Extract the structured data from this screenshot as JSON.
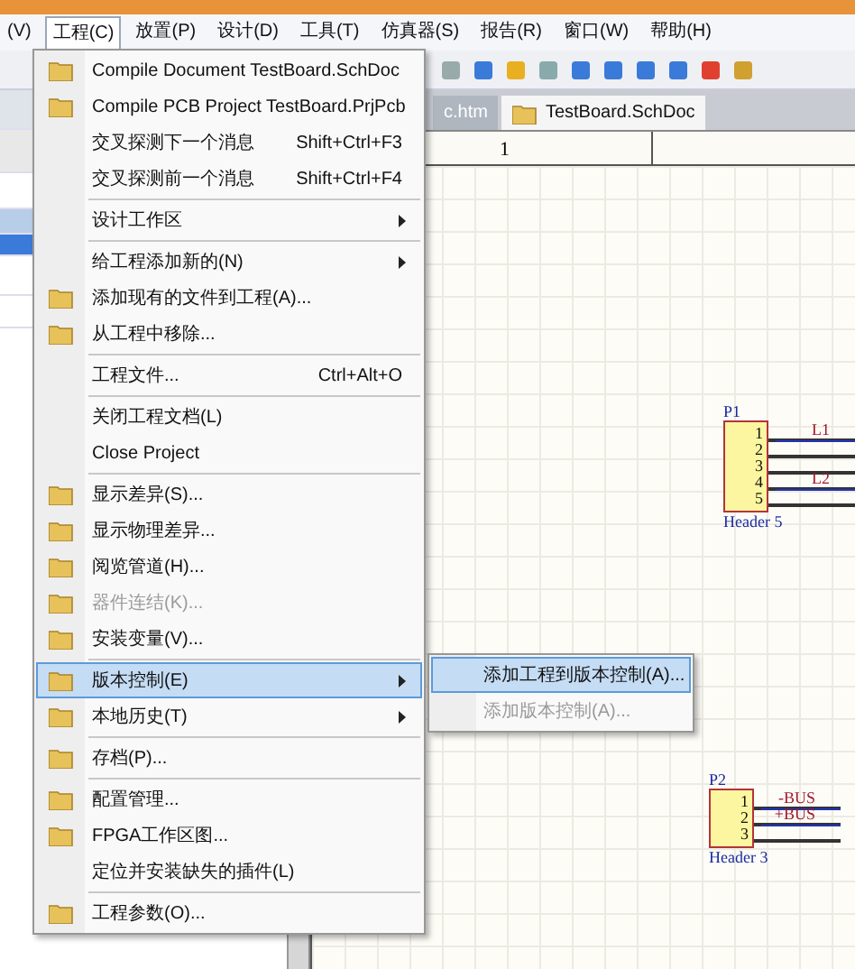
{
  "menubar": [
    {
      "label": "(V)",
      "selected": false
    },
    {
      "label": "工程(C)",
      "selected": true
    },
    {
      "label": "放置(P)",
      "selected": false
    },
    {
      "label": "设计(D)",
      "selected": false
    },
    {
      "label": "工具(T)",
      "selected": false
    },
    {
      "label": "仿真器(S)",
      "selected": false
    },
    {
      "label": "报告(R)",
      "selected": false
    },
    {
      "label": "窗口(W)",
      "selected": false
    },
    {
      "label": "帮助(H)",
      "selected": false
    }
  ],
  "document_tabs": [
    {
      "label": "c.htm",
      "selected": false
    },
    {
      "label": "TestBoard.SchDoc",
      "selected": true
    }
  ],
  "ruler": {
    "label": "1"
  },
  "menu": {
    "items": [
      {
        "kind": "icon_item",
        "label": "Compile Document TestBoard.SchDoc",
        "disabled": false,
        "selected": false,
        "submenu": false
      },
      {
        "kind": "icon_item",
        "label": "Compile PCB Project TestBoard.PrjPcb",
        "disabled": false,
        "selected": false,
        "submenu": false
      },
      {
        "kind": "item",
        "label": "交叉探测下一个消息",
        "shortcut": "Shift+Ctrl+F3",
        "disabled": false,
        "selected": false,
        "submenu": false
      },
      {
        "kind": "item",
        "label": "交叉探测前一个消息",
        "shortcut": "Shift+Ctrl+F4",
        "disabled": false,
        "selected": false,
        "submenu": false
      },
      {
        "kind": "separator"
      },
      {
        "kind": "item",
        "label": "设计工作区",
        "disabled": false,
        "selected": false,
        "submenu": true
      },
      {
        "kind": "separator"
      },
      {
        "kind": "item",
        "label": "给工程添加新的(N)",
        "disabled": false,
        "selected": false,
        "submenu": true
      },
      {
        "kind": "icon_item",
        "label": "添加现有的文件到工程(A)...",
        "disabled": false,
        "selected": false,
        "submenu": false
      },
      {
        "kind": "icon_item",
        "label": "从工程中移除...",
        "disabled": false,
        "selected": false,
        "submenu": false
      },
      {
        "kind": "separator"
      },
      {
        "kind": "item",
        "label": "工程文件...",
        "shortcut": "Ctrl+Alt+O",
        "disabled": false,
        "selected": false,
        "submenu": false
      },
      {
        "kind": "separator"
      },
      {
        "kind": "item",
        "label": "关闭工程文档(L)",
        "disabled": false,
        "selected": false,
        "submenu": false
      },
      {
        "kind": "item",
        "label": "Close Project",
        "disabled": false,
        "selected": false,
        "submenu": false
      },
      {
        "kind": "separator"
      },
      {
        "kind": "icon_item",
        "label": "显示差异(S)...",
        "disabled": false,
        "selected": false,
        "submenu": false
      },
      {
        "kind": "icon_item",
        "label": "显示物理差异...",
        "disabled": false,
        "selected": false,
        "submenu": false
      },
      {
        "kind": "icon_item",
        "label": "阅览管道(H)...",
        "disabled": false,
        "selected": false,
        "submenu": false
      },
      {
        "kind": "icon_item",
        "label": "器件连结(K)...",
        "disabled": true,
        "selected": false,
        "submenu": false
      },
      {
        "kind": "icon_item",
        "label": "安装变量(V)...",
        "disabled": false,
        "selected": false,
        "submenu": false
      },
      {
        "kind": "separator"
      },
      {
        "kind": "icon_item",
        "label": "版本控制(E)",
        "disabled": false,
        "selected": true,
        "submenu": true
      },
      {
        "kind": "icon_item",
        "label": "本地历史(T)",
        "disabled": false,
        "selected": false,
        "submenu": true
      },
      {
        "kind": "separator"
      },
      {
        "kind": "icon_item",
        "label": "存档(P)...",
        "disabled": false,
        "selected": false,
        "submenu": false
      },
      {
        "kind": "separator"
      },
      {
        "kind": "icon_item",
        "label": "配置管理...",
        "disabled": false,
        "selected": false,
        "submenu": false
      },
      {
        "kind": "icon_item",
        "label": "FPGA工作区图...",
        "disabled": false,
        "selected": false,
        "submenu": false
      },
      {
        "kind": "item",
        "label": "定位并安装缺失的插件(L)",
        "disabled": false,
        "selected": false,
        "submenu": false
      },
      {
        "kind": "separator"
      },
      {
        "kind": "icon_item",
        "label": "工程参数(O)...",
        "disabled": false,
        "selected": false,
        "submenu": false
      }
    ]
  },
  "submenu": {
    "items": [
      {
        "label": "添加工程到版本控制(A)...",
        "selected": true,
        "disabled": false
      },
      {
        "label": "添加版本控制(A)...",
        "selected": false,
        "disabled": true
      }
    ]
  },
  "schematic": {
    "parts": [
      {
        "designator": "P1",
        "pins": [
          {
            "number": "1",
            "net": "L1"
          },
          {
            "number": "2"
          },
          {
            "number": "3"
          },
          {
            "number": "4",
            "net": "L2"
          },
          {
            "number": "5"
          }
        ],
        "comment": "Header 5"
      },
      {
        "designator": "P2",
        "pins": [
          {
            "number": "1",
            "net": "-BUS"
          },
          {
            "number": "2",
            "net": "+BUS"
          },
          {
            "number": "3"
          }
        ],
        "comment": "Header 3"
      }
    ]
  }
}
